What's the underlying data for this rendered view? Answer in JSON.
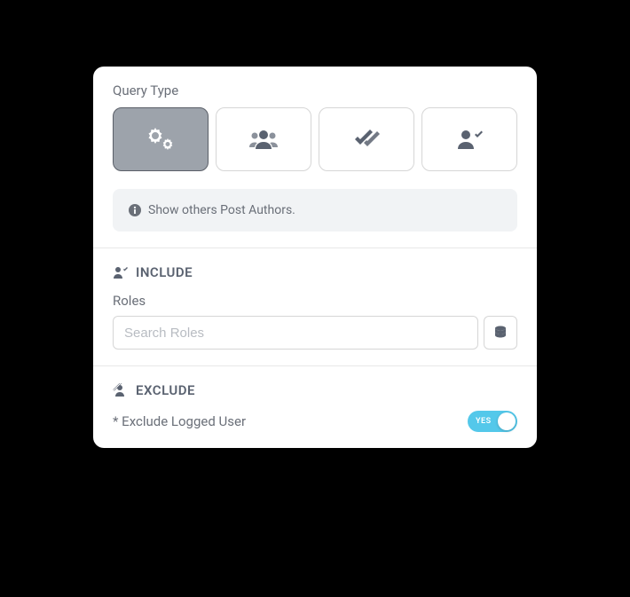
{
  "queryType": {
    "label": "Query Type",
    "info": "Show others Post Authors."
  },
  "include": {
    "title": "INCLUDE",
    "rolesLabel": "Roles",
    "searchPlaceholder": "Search Roles"
  },
  "exclude": {
    "title": "EXCLUDE",
    "loggedUserLabel": "* Exclude Logged User",
    "toggleText": "YES"
  }
}
